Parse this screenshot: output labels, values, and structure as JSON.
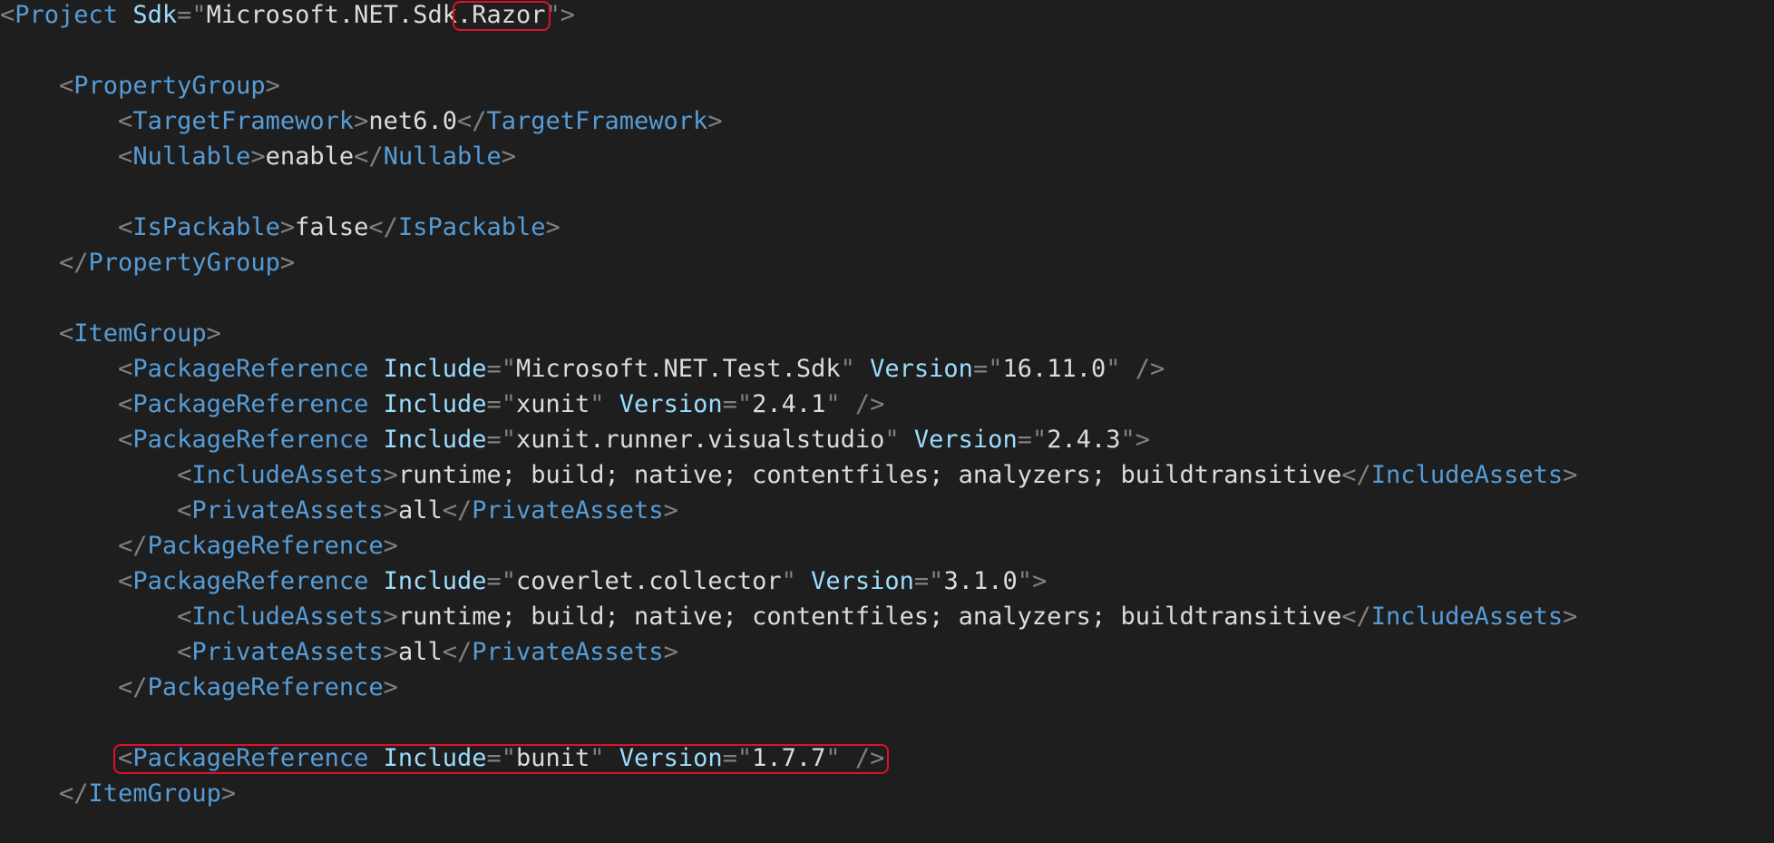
{
  "editor": {
    "language": "xml",
    "colors": {
      "background": "#1e1e1e",
      "punctuation": "#808080",
      "tag": "#569cd6",
      "attribute": "#9cdcfe",
      "value": "#dcdcdc",
      "highlight": "#e0102a"
    },
    "lines": [
      [
        [
          "p",
          "<"
        ],
        [
          "t",
          "Project"
        ],
        [
          "v",
          " "
        ],
        [
          "a",
          "Sdk"
        ],
        [
          "p",
          "=\""
        ],
        [
          "v",
          "Microsoft.NET.Sdk"
        ],
        [
          "v",
          ".Razor",
          "hl"
        ],
        [
          "p",
          "\">"
        ]
      ],
      [],
      [
        [
          "v",
          "    "
        ],
        [
          "p",
          "<"
        ],
        [
          "t",
          "PropertyGroup"
        ],
        [
          "p",
          ">"
        ]
      ],
      [
        [
          "v",
          "        "
        ],
        [
          "p",
          "<"
        ],
        [
          "t",
          "TargetFramework"
        ],
        [
          "p",
          ">"
        ],
        [
          "v",
          "net6.0"
        ],
        [
          "p",
          "</"
        ],
        [
          "t",
          "TargetFramework"
        ],
        [
          "p",
          ">"
        ]
      ],
      [
        [
          "v",
          "        "
        ],
        [
          "p",
          "<"
        ],
        [
          "t",
          "Nullable"
        ],
        [
          "p",
          ">"
        ],
        [
          "v",
          "enable"
        ],
        [
          "p",
          "</"
        ],
        [
          "t",
          "Nullable"
        ],
        [
          "p",
          ">"
        ]
      ],
      [],
      [
        [
          "v",
          "        "
        ],
        [
          "p",
          "<"
        ],
        [
          "t",
          "IsPackable"
        ],
        [
          "p",
          ">"
        ],
        [
          "v",
          "false"
        ],
        [
          "p",
          "</"
        ],
        [
          "t",
          "IsPackable"
        ],
        [
          "p",
          ">"
        ]
      ],
      [
        [
          "v",
          "    "
        ],
        [
          "p",
          "</"
        ],
        [
          "t",
          "PropertyGroup"
        ],
        [
          "p",
          ">"
        ]
      ],
      [],
      [
        [
          "v",
          "    "
        ],
        [
          "p",
          "<"
        ],
        [
          "t",
          "ItemGroup"
        ],
        [
          "p",
          ">"
        ]
      ],
      [
        [
          "v",
          "        "
        ],
        [
          "p",
          "<"
        ],
        [
          "t",
          "PackageReference"
        ],
        [
          "v",
          " "
        ],
        [
          "a",
          "Include"
        ],
        [
          "p",
          "=\""
        ],
        [
          "v",
          "Microsoft.NET.Test.Sdk"
        ],
        [
          "p",
          "\""
        ],
        [
          "v",
          " "
        ],
        [
          "a",
          "Version"
        ],
        [
          "p",
          "=\""
        ],
        [
          "v",
          "16.11.0"
        ],
        [
          "p",
          "\" />"
        ]
      ],
      [
        [
          "v",
          "        "
        ],
        [
          "p",
          "<"
        ],
        [
          "t",
          "PackageReference"
        ],
        [
          "v",
          " "
        ],
        [
          "a",
          "Include"
        ],
        [
          "p",
          "=\""
        ],
        [
          "v",
          "xunit"
        ],
        [
          "p",
          "\""
        ],
        [
          "v",
          " "
        ],
        [
          "a",
          "Version"
        ],
        [
          "p",
          "=\""
        ],
        [
          "v",
          "2.4.1"
        ],
        [
          "p",
          "\" />"
        ]
      ],
      [
        [
          "v",
          "        "
        ],
        [
          "p",
          "<"
        ],
        [
          "t",
          "PackageReference"
        ],
        [
          "v",
          " "
        ],
        [
          "a",
          "Include"
        ],
        [
          "p",
          "=\""
        ],
        [
          "v",
          "xunit.runner.visualstudio"
        ],
        [
          "p",
          "\""
        ],
        [
          "v",
          " "
        ],
        [
          "a",
          "Version"
        ],
        [
          "p",
          "=\""
        ],
        [
          "v",
          "2.4.3"
        ],
        [
          "p",
          "\">"
        ]
      ],
      [
        [
          "v",
          "            "
        ],
        [
          "p",
          "<"
        ],
        [
          "t",
          "IncludeAssets"
        ],
        [
          "p",
          ">"
        ],
        [
          "v",
          "runtime; build; native; contentfiles; analyzers; buildtransitive"
        ],
        [
          "p",
          "</"
        ],
        [
          "t",
          "IncludeAssets"
        ],
        [
          "p",
          ">"
        ]
      ],
      [
        [
          "v",
          "            "
        ],
        [
          "p",
          "<"
        ],
        [
          "t",
          "PrivateAssets"
        ],
        [
          "p",
          ">"
        ],
        [
          "v",
          "all"
        ],
        [
          "p",
          "</"
        ],
        [
          "t",
          "PrivateAssets"
        ],
        [
          "p",
          ">"
        ]
      ],
      [
        [
          "v",
          "        "
        ],
        [
          "p",
          "</"
        ],
        [
          "t",
          "PackageReference"
        ],
        [
          "p",
          ">"
        ]
      ],
      [
        [
          "v",
          "        "
        ],
        [
          "p",
          "<"
        ],
        [
          "t",
          "PackageReference"
        ],
        [
          "v",
          " "
        ],
        [
          "a",
          "Include"
        ],
        [
          "p",
          "=\""
        ],
        [
          "v",
          "coverlet.collector"
        ],
        [
          "p",
          "\""
        ],
        [
          "v",
          " "
        ],
        [
          "a",
          "Version"
        ],
        [
          "p",
          "=\""
        ],
        [
          "v",
          "3.1.0"
        ],
        [
          "p",
          "\">"
        ]
      ],
      [
        [
          "v",
          "            "
        ],
        [
          "p",
          "<"
        ],
        [
          "t",
          "IncludeAssets"
        ],
        [
          "p",
          ">"
        ],
        [
          "v",
          "runtime; build; native; contentfiles; analyzers; buildtransitive"
        ],
        [
          "p",
          "</"
        ],
        [
          "t",
          "IncludeAssets"
        ],
        [
          "p",
          ">"
        ]
      ],
      [
        [
          "v",
          "            "
        ],
        [
          "p",
          "<"
        ],
        [
          "t",
          "PrivateAssets"
        ],
        [
          "p",
          ">"
        ],
        [
          "v",
          "all"
        ],
        [
          "p",
          "</"
        ],
        [
          "t",
          "PrivateAssets"
        ],
        [
          "p",
          ">"
        ]
      ],
      [
        [
          "v",
          "        "
        ],
        [
          "p",
          "</"
        ],
        [
          "t",
          "PackageReference"
        ],
        [
          "p",
          ">"
        ]
      ],
      [],
      [
        [
          "v",
          "        "
        ],
        [
          "p",
          "<",
          "hl"
        ],
        [
          "t",
          "PackageReference",
          "hl"
        ],
        [
          "v",
          " ",
          "hl"
        ],
        [
          "a",
          "Include",
          "hl"
        ],
        [
          "p",
          "=\"",
          "hl"
        ],
        [
          "v",
          "bunit",
          "hl"
        ],
        [
          "p",
          "\"",
          "hl"
        ],
        [
          "v",
          " ",
          "hl"
        ],
        [
          "a",
          "Version",
          "hl"
        ],
        [
          "p",
          "=\"",
          "hl"
        ],
        [
          "v",
          "1.7.7",
          "hl"
        ],
        [
          "p",
          "\" />",
          "hl"
        ]
      ],
      [
        [
          "v",
          "    "
        ],
        [
          "p",
          "</"
        ],
        [
          "t",
          "ItemGroup"
        ],
        [
          "p",
          ">"
        ]
      ]
    ]
  }
}
